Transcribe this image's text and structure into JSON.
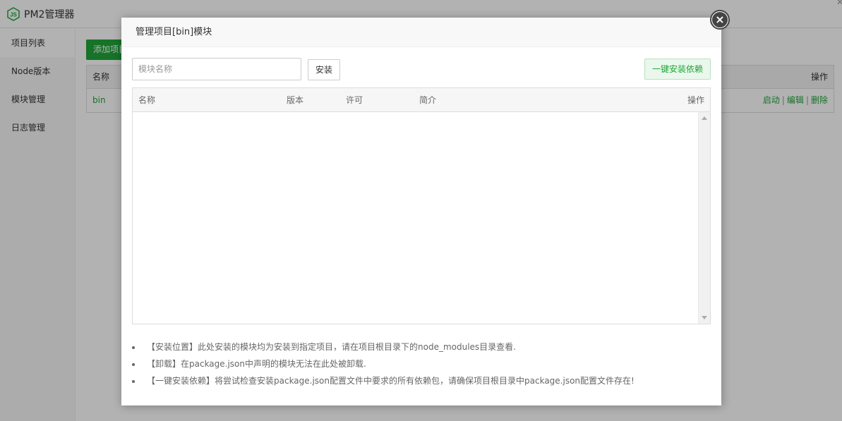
{
  "app": {
    "title": "PM2管理器"
  },
  "sidebar": {
    "items": [
      {
        "label": "项目列表"
      },
      {
        "label": "Node版本"
      },
      {
        "label": "模块管理"
      },
      {
        "label": "日志管理"
      }
    ]
  },
  "main": {
    "add_button_label": "添加项目",
    "table": {
      "header": {
        "name": "名称",
        "actions": "操作"
      },
      "rows": [
        {
          "name": "bin",
          "start": "启动",
          "edit": "编辑",
          "delete": "删除",
          "separator": "|"
        }
      ]
    }
  },
  "dialog": {
    "title": "管理项目[bin]模块",
    "input_placeholder": "模块名称",
    "install_button": "安装",
    "install_all_button": "一键安装依赖",
    "columns": {
      "name": "名称",
      "version": "版本",
      "license": "许可",
      "description": "简介",
      "actions": "操作"
    },
    "notes": [
      "【安装位置】此处安装的模块均为安装到指定项目，请在项目根目录下的node_modules目录查看.",
      "【卸载】在package.json中声明的模块无法在此处被卸载.",
      "【一键安装依赖】将尝试检查安装package.json配置文件中要求的所有依赖包，请确保项目根目录中package.json配置文件存在!"
    ]
  },
  "colors": {
    "accent": "#20a53a",
    "overlay": "rgba(0,0,0,0.3)"
  }
}
